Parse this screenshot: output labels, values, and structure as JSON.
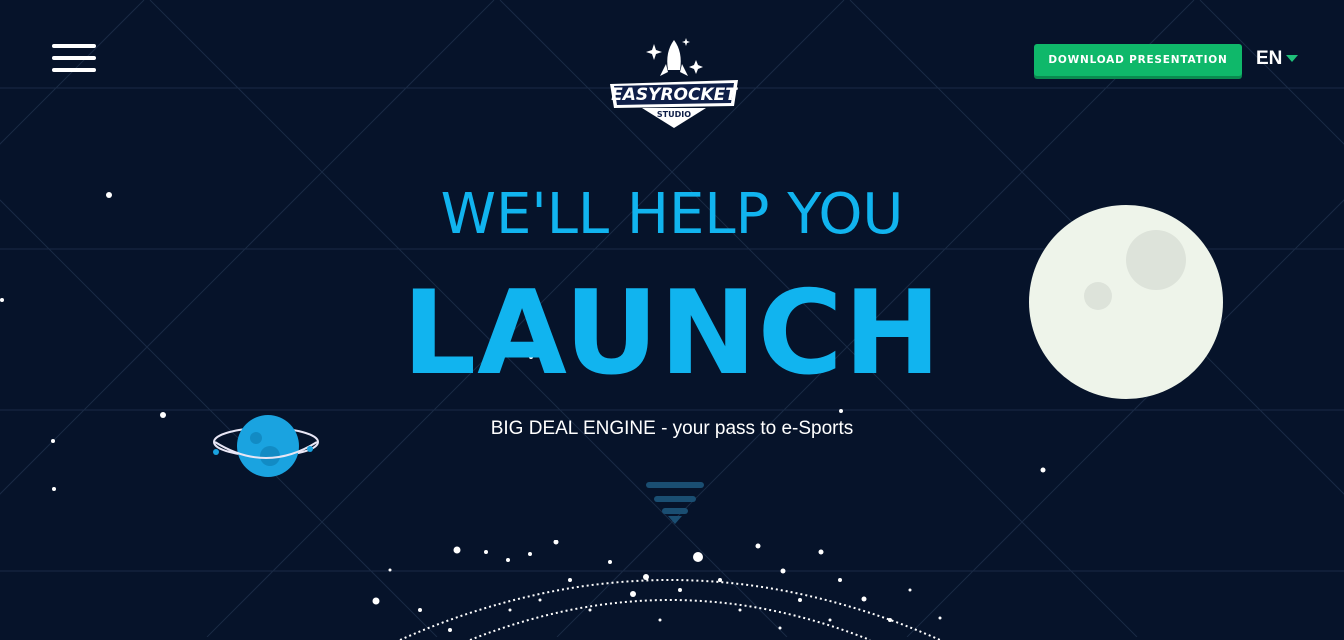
{
  "header": {
    "menu_icon": "hamburger-icon",
    "logo": {
      "main_text": "EASYROCKET",
      "sub_text": "STUDIO"
    },
    "download_label": "DOWNLOAD PRESENTATION",
    "language": "EN"
  },
  "hero": {
    "line1": "WE'LL HELP YOU",
    "line2": "LAUNCH",
    "tagline": "BIG DEAL ENGINE - your pass to e-Sports"
  },
  "colors": {
    "background": "#06132a",
    "accent": "#11b4ef",
    "button": "#0fb86a",
    "moon": "#eef4ea"
  }
}
